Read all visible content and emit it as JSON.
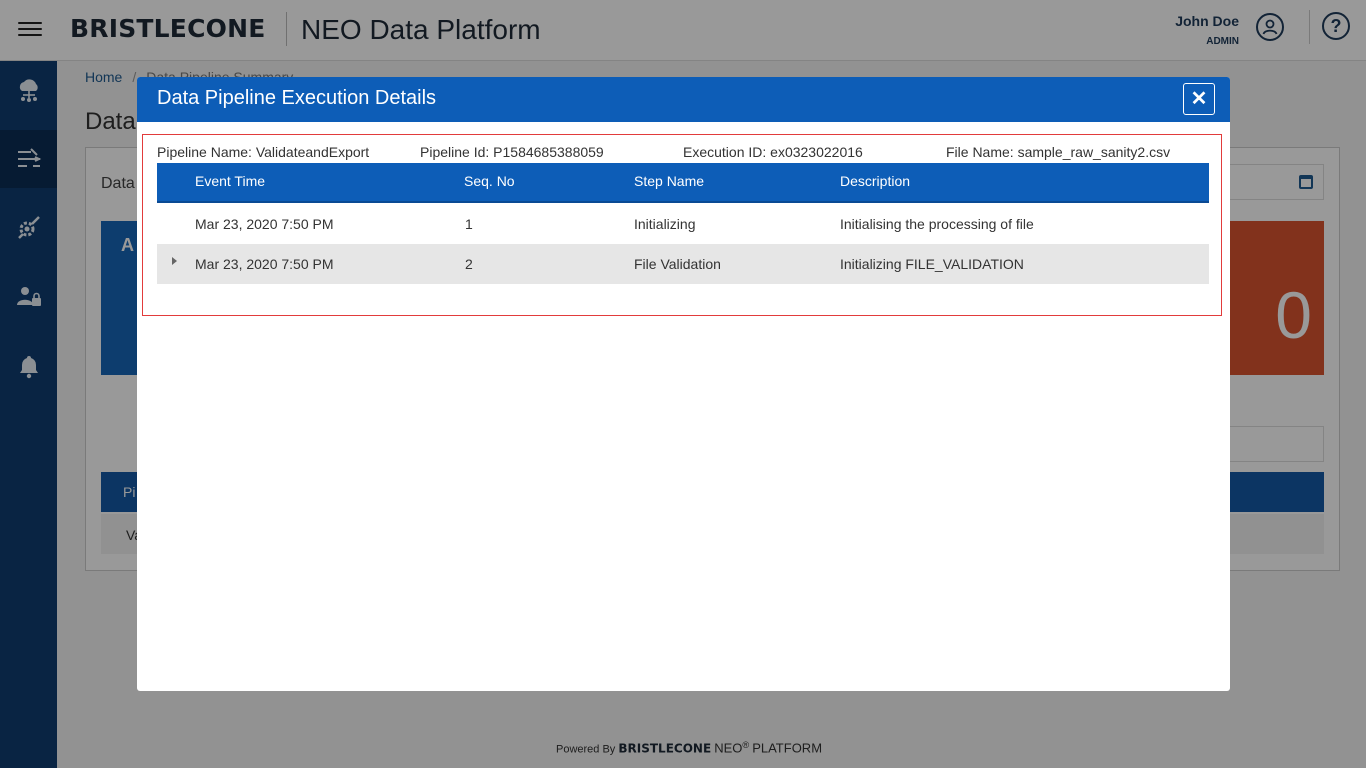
{
  "header": {
    "brand": "BRISTLECONE",
    "app_title": "NEO Data Platform",
    "user_name": "John Doe",
    "user_role": "ADMIN"
  },
  "sidebar": {
    "items": [
      {
        "icon": "cloud-network-icon"
      },
      {
        "icon": "pipeline-icon",
        "active": true
      },
      {
        "icon": "settings-tools-icon"
      },
      {
        "icon": "user-admin-icon"
      },
      {
        "icon": "bell-icon"
      }
    ]
  },
  "breadcrumb": {
    "home": "Home",
    "separator": "/",
    "current": "Data Pipeline Summary"
  },
  "page": {
    "title": "Data",
    "panel_label": "Data",
    "blue_card_text": "A",
    "orange_card_value": "0",
    "table_header_text": "Pi",
    "table_row_text": "Va"
  },
  "modal": {
    "title": "Data Pipeline Execution Details",
    "close_label": "✕",
    "pipeline_name": "Pipeline Name: ValidateandExport",
    "pipeline_id": "Pipeline Id: P1584685388059",
    "execution_id": "Execution ID: ex0323022016",
    "file_name": "File Name: sample_raw_sanity2.csv",
    "columns": [
      "Event Time",
      "Seq. No",
      "Step Name",
      "Description"
    ],
    "rows": [
      {
        "event_time": "Mar 23, 2020 7:50 PM",
        "seq": "1",
        "step": "Initializing",
        "description": "Initialising the processing of file"
      },
      {
        "event_time": "Mar 23, 2020 7:50 PM",
        "seq": "2",
        "step": "File Validation",
        "description": "Initializing FILE_VALIDATION"
      }
    ]
  },
  "footer": {
    "powered_by": "Powered By",
    "brand": "BRISTLECONE",
    "neo": "NEO",
    "reg": "®",
    "platform": "PLATFORM"
  },
  "colors": {
    "primary": "#0d5db7",
    "sidebar": "#0f3d70",
    "accent_orange": "#d9542f",
    "highlight_frame": "#e23b3b"
  }
}
